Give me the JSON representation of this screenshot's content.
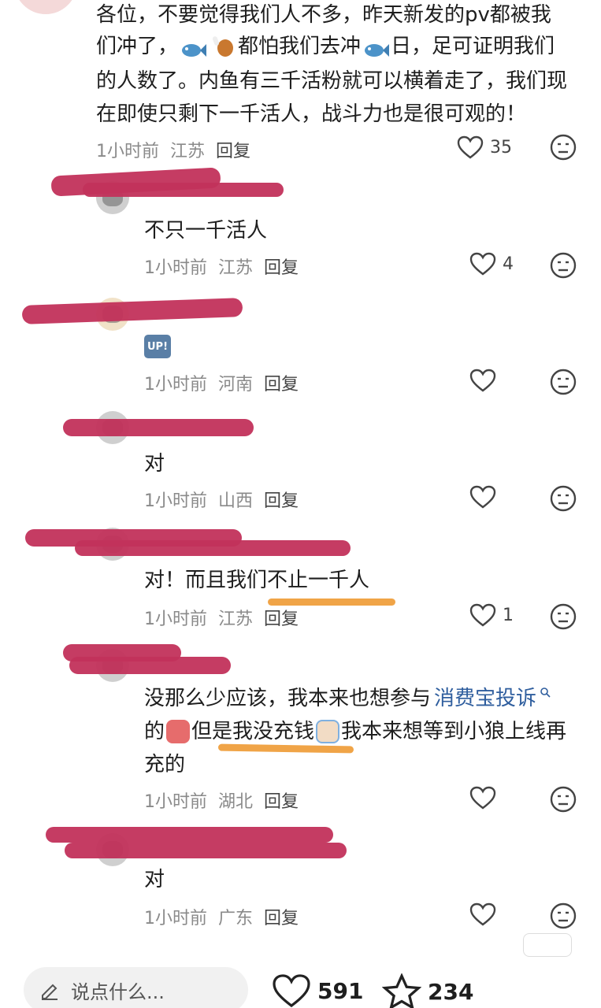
{
  "top_comment": {
    "lines": [
      "各位，不要觉得我们人不多，昨天新发的pv都被我",
      "们冲了，",
      "都怕我们去冲",
      "日，足可证明我们",
      "的人数了。内鱼有三千活粉就可以横着走了，我们现",
      "在即使只剩下一千活人，战斗力也是很可观的！"
    ],
    "time": "1小时前",
    "location": "江苏",
    "reply": "回复",
    "likes": "35"
  },
  "replies": [
    {
      "text": "不只一千活人",
      "time": "1小时前",
      "location": "江苏",
      "reply": "回复",
      "likes": "4"
    },
    {
      "badge": "UP!",
      "time": "1小时前",
      "location": "河南",
      "reply": "回复",
      "likes": ""
    },
    {
      "text": "对",
      "time": "1小时前",
      "location": "山西",
      "reply": "回复",
      "likes": ""
    },
    {
      "text": "对！而且我们不止一千人",
      "time": "1小时前",
      "location": "江苏",
      "reply": "回复",
      "likes": "1"
    },
    {
      "line1": "没那么少应该，我本来也想参与",
      "link": "消费宝投诉",
      "line2a": "的",
      "line2b": "但是我没充钱",
      "line2c": "我本来想等到小狼上线再",
      "line3": "充的",
      "time": "1小时前",
      "location": "湖北",
      "reply": "回复",
      "likes": ""
    },
    {
      "text": "对",
      "time": "1小时前",
      "location": "广东",
      "reply": "回复",
      "likes": ""
    }
  ],
  "bottom_bar": {
    "input_placeholder": "说点什么...",
    "likes": "591",
    "favorites": "234"
  },
  "colors": {
    "redaction": "#c2325b",
    "highlight": "#f0a447",
    "link": "#2f5e9e"
  },
  "icons": [
    "heart-icon",
    "dislike-face-icon",
    "pencil-icon",
    "star-icon",
    "search-icon"
  ]
}
